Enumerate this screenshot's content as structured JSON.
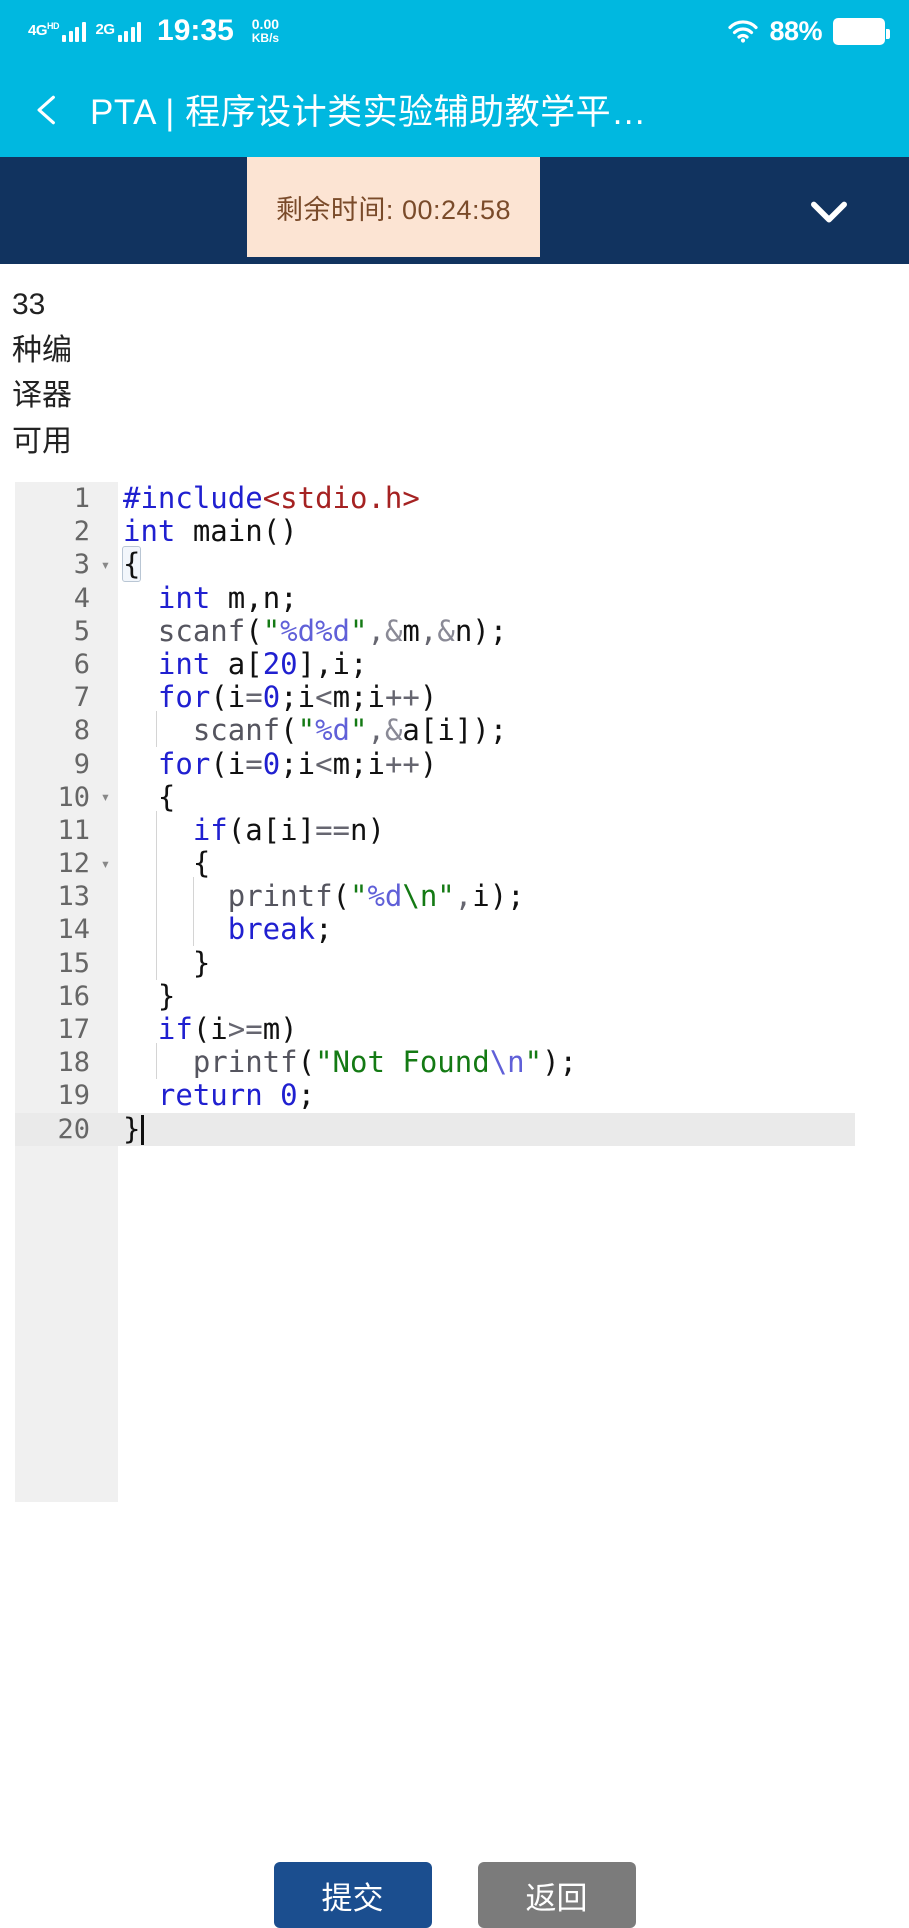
{
  "status_bar": {
    "network_primary": "4G",
    "network_primary_sup": "HD",
    "network_secondary": "2G",
    "time": "19:35",
    "net_speed": "0.00",
    "net_speed_unit": "KB/s",
    "battery_percent": "88%",
    "wifi_icon": "wifi-icon",
    "battery_icon": "battery-icon"
  },
  "app_bar": {
    "back_icon": "chevron-left-icon",
    "title": "PTA | 程序设计类实验辅助教学平…"
  },
  "timer_bar": {
    "remaining_label": "剩余时间: 00:24:58",
    "collapse_icon": "chevron-down-icon",
    "background_color": "#11335f",
    "box_color": "#fce4d3",
    "text_color": "#7a4b2a"
  },
  "description": {
    "lines": [
      "33",
      "种编",
      "译器",
      "可用"
    ]
  },
  "editor": {
    "language": "c",
    "active_line": 20,
    "lines": [
      {
        "n": "1",
        "fold": "",
        "indent_guides": []
      },
      {
        "n": "2",
        "fold": "",
        "indent_guides": []
      },
      {
        "n": "3",
        "fold": "▾",
        "indent_guides": []
      },
      {
        "n": "4",
        "fold": "",
        "indent_guides": []
      },
      {
        "n": "5",
        "fold": "",
        "indent_guides": []
      },
      {
        "n": "6",
        "fold": "",
        "indent_guides": []
      },
      {
        "n": "7",
        "fold": "",
        "indent_guides": []
      },
      {
        "n": "8",
        "fold": "",
        "indent_guides": [
          38
        ]
      },
      {
        "n": "9",
        "fold": "",
        "indent_guides": []
      },
      {
        "n": "10",
        "fold": "▾",
        "indent_guides": []
      },
      {
        "n": "11",
        "fold": "",
        "indent_guides": [
          38
        ]
      },
      {
        "n": "12",
        "fold": "▾",
        "indent_guides": [
          38
        ]
      },
      {
        "n": "13",
        "fold": "",
        "indent_guides": [
          38,
          75
        ]
      },
      {
        "n": "14",
        "fold": "",
        "indent_guides": [
          38,
          75
        ]
      },
      {
        "n": "15",
        "fold": "",
        "indent_guides": [
          38
        ]
      },
      {
        "n": "16",
        "fold": "",
        "indent_guides": []
      },
      {
        "n": "17",
        "fold": "",
        "indent_guides": []
      },
      {
        "n": "18",
        "fold": "",
        "indent_guides": [
          38
        ]
      },
      {
        "n": "19",
        "fold": "",
        "indent_guides": []
      },
      {
        "n": "20",
        "fold": "",
        "indent_guides": []
      }
    ],
    "source_text": [
      "#include<stdio.h>",
      "int main()",
      "{",
      "  int m,n;",
      "  scanf(\"%d%d\",&m,&n);",
      "  int a[20],i;",
      "  for(i=0;i<m;i++)",
      "    scanf(\"%d\",&a[i]);",
      "  for(i=0;i<m;i++)",
      "  {",
      "    if(a[i]==n)",
      "    {",
      "      printf(\"%d\\n\",i);",
      "      break;",
      "    }",
      "  }",
      "  if(i>=m)",
      "    printf(\"Not Found\\n\");",
      "  return 0;",
      "}"
    ],
    "colors": {
      "keyword": "#2020d0",
      "include_path": "#a52222",
      "string": "#147a14",
      "format_spec": "#6060d8",
      "number": "#2020d0",
      "function": "#55555f",
      "gutter_bg": "#f0f0f0",
      "active_line_bg": "#eaeaea"
    }
  },
  "buttons": {
    "submit": "提交",
    "back": "返回",
    "submit_color": "#1b4e8f",
    "back_color": "#7b7b7b"
  }
}
